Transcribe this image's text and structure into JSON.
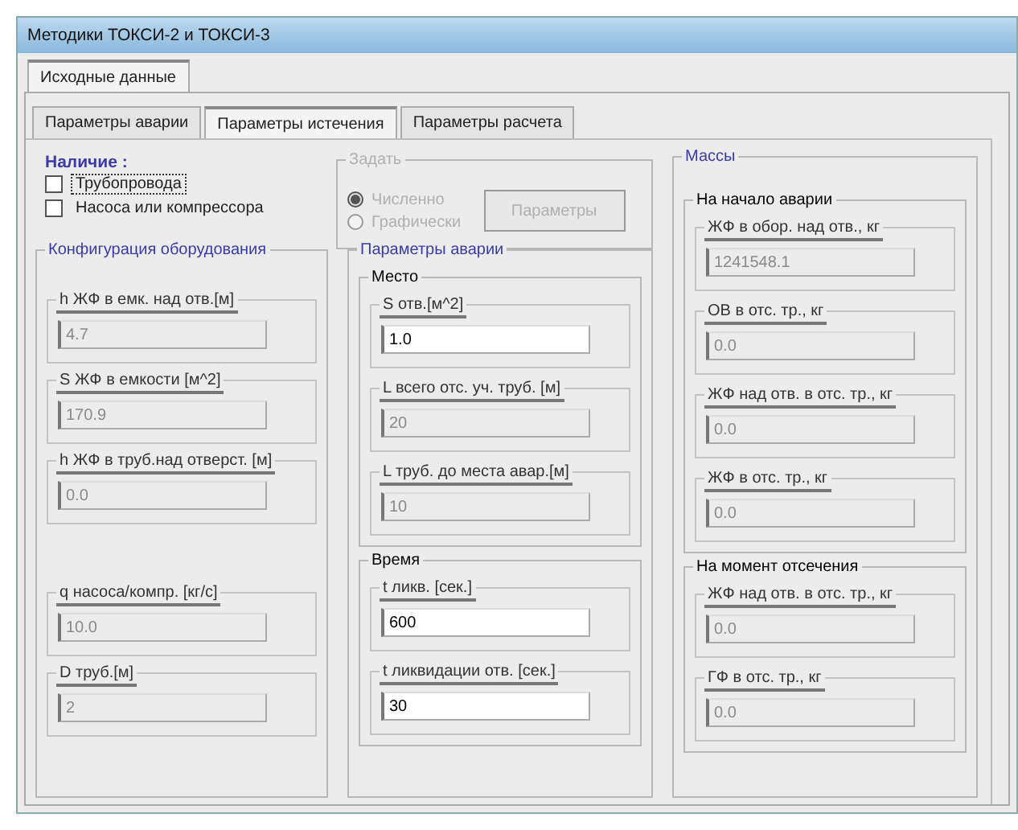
{
  "window": {
    "title": "Методики ТОКСИ-2 и ТОКСИ-3"
  },
  "outer_tabs": [
    {
      "label": "Исходные данные",
      "selected": true
    }
  ],
  "inner_tabs": [
    {
      "label": "Параметры аварии",
      "selected": false
    },
    {
      "label": "Параметры истечения",
      "selected": true
    },
    {
      "label": "Параметры расчета",
      "selected": false
    }
  ],
  "presence": {
    "title": "Наличие :",
    "checkboxes": [
      {
        "label": "Трубопровода",
        "checked": false,
        "focused": true
      },
      {
        "label": "Насоса или компрессора",
        "checked": false,
        "focused": false
      }
    ]
  },
  "set_mode": {
    "title": "Задать",
    "disabled": true,
    "radios": [
      {
        "label": "Численно",
        "selected": true
      },
      {
        "label": "Графически",
        "selected": false
      }
    ],
    "button": "Параметры"
  },
  "equipment": {
    "title": "Конфигурация оборудования",
    "fields": [
      {
        "label": "h ЖФ в емк. над отв.[м]",
        "value": "4.7",
        "disabled": true
      },
      {
        "label": "S ЖФ в емкости [м^2]",
        "value": "170.9",
        "disabled": true
      },
      {
        "label": "h ЖФ в труб.над отверст. [м]",
        "value": "0.0",
        "disabled": true
      },
      {
        "label": "q насоса/компр. [кг/с]",
        "value": "10.0",
        "disabled": true
      },
      {
        "label": "D труб.[м]",
        "value": "2",
        "disabled": true
      }
    ]
  },
  "accident": {
    "title": "Параметры аварии",
    "groups": [
      {
        "title": "Место",
        "fields": [
          {
            "label": "S отв.[м^2]",
            "value": "1.0",
            "disabled": false
          },
          {
            "label": "L всего отс. уч. труб. [м]",
            "value": "20",
            "disabled": true
          },
          {
            "label": "L труб. до места авар.[м]",
            "value": "10",
            "disabled": true
          }
        ]
      },
      {
        "title": "Время",
        "fields": [
          {
            "label": "t ликв. [сек.]",
            "value": "600",
            "disabled": false
          },
          {
            "label": "t ликвидации отв. [сек.]",
            "value": "30",
            "disabled": false
          }
        ]
      }
    ]
  },
  "masses": {
    "title": "Массы",
    "groups": [
      {
        "title": "На начало аварии",
        "fields": [
          {
            "label": "ЖФ в обор. над отв., кг",
            "value": "1241548.1",
            "disabled": true
          },
          {
            "label": "ОВ в отс. тр., кг",
            "value": "0.0",
            "disabled": true
          },
          {
            "label": "ЖФ над отв. в отс. тр., кг",
            "value": "0.0",
            "disabled": true
          },
          {
            "label": "ЖФ в отс. тр., кг",
            "value": "0.0",
            "disabled": true
          }
        ]
      },
      {
        "title": "На момент отсечения",
        "fields": [
          {
            "label": "ЖФ над отв. в отс. тр., кг",
            "value": "0.0",
            "disabled": true
          },
          {
            "label": "ГФ в отс. тр., кг",
            "value": "0.0",
            "disabled": true
          }
        ]
      }
    ]
  }
}
